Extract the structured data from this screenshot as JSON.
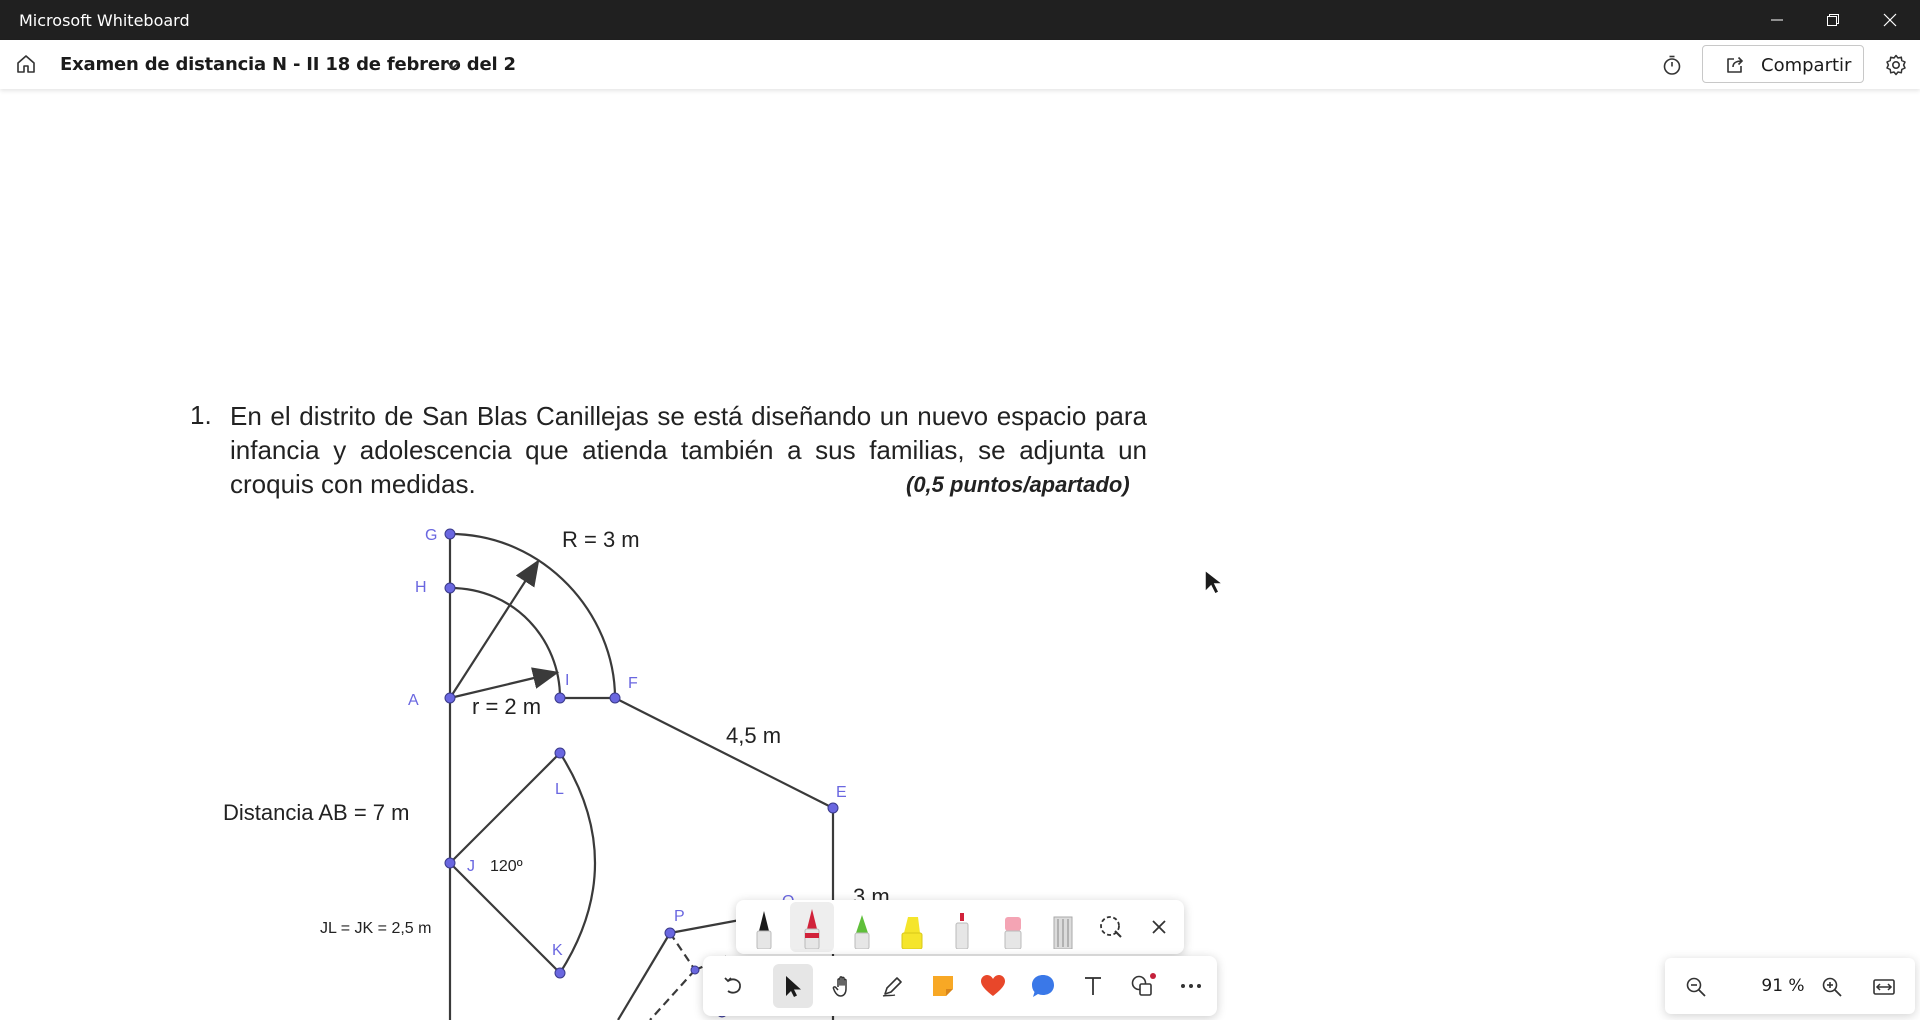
{
  "window": {
    "title": "Microsoft Whiteboard"
  },
  "appbar": {
    "board_title": "Examen de distancia N - II 18 de febrero del 2",
    "share_label": "Compartir"
  },
  "document": {
    "question_number": "1.",
    "question_text": "En el distrito de San Blas Canillejas se está diseñando un nuevo espacio para infancia y adolescencia que atienda también a sus familias, se adjunta un croquis con medidas.",
    "points": "(0,5 puntos/apartado)",
    "figure": {
      "point_labels": [
        "G",
        "H",
        "A",
        "I",
        "F",
        "E",
        "L",
        "J",
        "K",
        "P",
        "O"
      ],
      "radius_outer": "R = 3 m",
      "radius_inner": "r = 2 m",
      "side_fe": "4,5 m",
      "distance_ab": "Distancia AB = 7 m",
      "angle": "120º",
      "jl_jk": "JL = JK = 2,5 m",
      "side_e": "3 m"
    }
  },
  "pen_tray": {
    "tools": [
      "black-pen-icon",
      "red-pen-icon",
      "green-highlighter-icon",
      "yellow-highlighter-icon",
      "spray-marker-icon",
      "eraser-icon",
      "ruler-icon",
      "lasso-icon",
      "close-icon"
    ],
    "colors": {
      "black": "#1b1b1b",
      "red": "#d1223a",
      "green": "#5fbf3a",
      "yellow": "#f5e52b",
      "eraser": "#f4a4b4"
    }
  },
  "toolbar": {
    "tools": [
      "undo-icon",
      "select-icon",
      "hand-icon",
      "pen-icon",
      "sticky-note-icon",
      "reaction-icon",
      "comment-icon",
      "text-icon",
      "shapes-icon",
      "more-icon"
    ],
    "colors": {
      "select_bg": "#e6e6e6",
      "sticky": "#f8a825",
      "heart": "#e8472a",
      "comment": "#3a78e8",
      "badge": "#c4213b"
    }
  },
  "zoom": {
    "level": "91 %"
  },
  "colors": {
    "titlebar": "#202020",
    "point": "#6a67e0",
    "line": "#3a3a3a"
  }
}
